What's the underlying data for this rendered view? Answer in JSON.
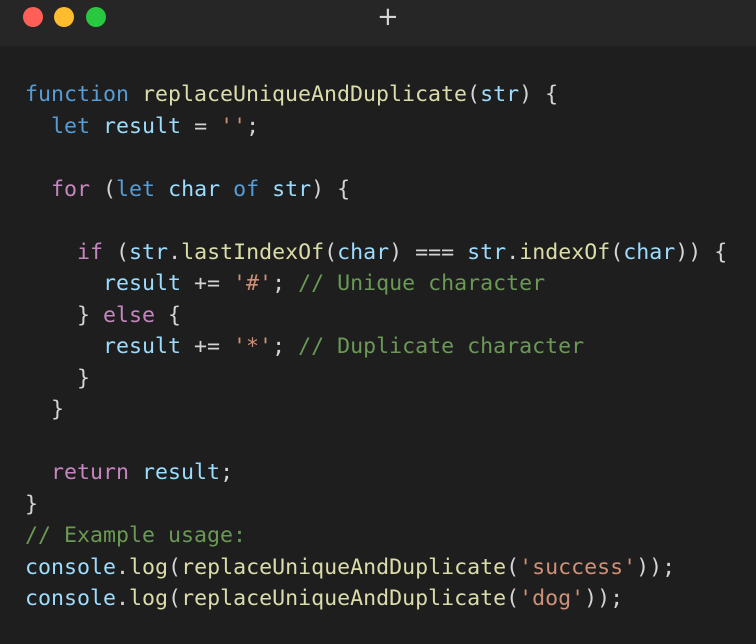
{
  "window": {
    "new_tab_icon": "plus-icon",
    "traffic_lights": [
      {
        "name": "close",
        "color": "#ff5f57"
      },
      {
        "name": "minimize",
        "color": "#febc2e"
      },
      {
        "name": "maximize",
        "color": "#28c840"
      }
    ]
  },
  "theme": {
    "keyword": "#569cd6",
    "control": "#c586c0",
    "function": "#dcdcaa",
    "variable": "#9cdcfe",
    "string": "#ce9178",
    "comment": "#6a9955",
    "punctuation": "#d4d4d4",
    "background": "#1e1e1e"
  },
  "code_lines": [
    [
      {
        "text": "function",
        "type": "kw"
      },
      {
        "text": " ",
        "type": "punc"
      },
      {
        "text": "replaceUniqueAndDuplicate",
        "type": "fn"
      },
      {
        "text": "(",
        "type": "punc"
      },
      {
        "text": "str",
        "type": "var"
      },
      {
        "text": ") {",
        "type": "punc"
      }
    ],
    [
      {
        "text": "  ",
        "type": "punc"
      },
      {
        "text": "let",
        "type": "kw"
      },
      {
        "text": " ",
        "type": "punc"
      },
      {
        "text": "result",
        "type": "var"
      },
      {
        "text": " = ",
        "type": "punc"
      },
      {
        "text": "''",
        "type": "str"
      },
      {
        "text": ";",
        "type": "punc"
      }
    ],
    [],
    [
      {
        "text": "  ",
        "type": "punc"
      },
      {
        "text": "for",
        "type": "ctrl"
      },
      {
        "text": " (",
        "type": "punc"
      },
      {
        "text": "let",
        "type": "kw"
      },
      {
        "text": " ",
        "type": "punc"
      },
      {
        "text": "char",
        "type": "var"
      },
      {
        "text": " ",
        "type": "punc"
      },
      {
        "text": "of",
        "type": "kw"
      },
      {
        "text": " ",
        "type": "punc"
      },
      {
        "text": "str",
        "type": "var"
      },
      {
        "text": ") {",
        "type": "punc"
      }
    ],
    [],
    [
      {
        "text": "    ",
        "type": "punc"
      },
      {
        "text": "if",
        "type": "ctrl"
      },
      {
        "text": " (",
        "type": "punc"
      },
      {
        "text": "str",
        "type": "var"
      },
      {
        "text": ".",
        "type": "punc"
      },
      {
        "text": "lastIndexOf",
        "type": "fn"
      },
      {
        "text": "(",
        "type": "punc"
      },
      {
        "text": "char",
        "type": "var"
      },
      {
        "text": ") ",
        "type": "punc"
      },
      {
        "text": "===",
        "type": "punc"
      },
      {
        "text": " ",
        "type": "punc"
      },
      {
        "text": "str",
        "type": "var"
      },
      {
        "text": ".",
        "type": "punc"
      },
      {
        "text": "indexOf",
        "type": "fn"
      },
      {
        "text": "(",
        "type": "punc"
      },
      {
        "text": "char",
        "type": "var"
      },
      {
        "text": ")) {",
        "type": "punc"
      }
    ],
    [
      {
        "text": "      ",
        "type": "punc"
      },
      {
        "text": "result",
        "type": "var"
      },
      {
        "text": " += ",
        "type": "punc"
      },
      {
        "text": "'#'",
        "type": "str"
      },
      {
        "text": "; ",
        "type": "punc"
      },
      {
        "text": "// Unique character",
        "type": "com"
      }
    ],
    [
      {
        "text": "    } ",
        "type": "punc"
      },
      {
        "text": "else",
        "type": "ctrl"
      },
      {
        "text": " {",
        "type": "punc"
      }
    ],
    [
      {
        "text": "      ",
        "type": "punc"
      },
      {
        "text": "result",
        "type": "var"
      },
      {
        "text": " += ",
        "type": "punc"
      },
      {
        "text": "'*'",
        "type": "str"
      },
      {
        "text": "; ",
        "type": "punc"
      },
      {
        "text": "// Duplicate character",
        "type": "com"
      }
    ],
    [
      {
        "text": "    }",
        "type": "punc"
      }
    ],
    [
      {
        "text": "  }",
        "type": "punc"
      }
    ],
    [],
    [
      {
        "text": "  ",
        "type": "punc"
      },
      {
        "text": "return",
        "type": "ctrl"
      },
      {
        "text": " ",
        "type": "punc"
      },
      {
        "text": "result",
        "type": "var"
      },
      {
        "text": ";",
        "type": "punc"
      }
    ],
    [
      {
        "text": "}",
        "type": "punc"
      }
    ],
    [
      {
        "text": "// Example usage:",
        "type": "com"
      }
    ],
    [
      {
        "text": "console",
        "type": "var"
      },
      {
        "text": ".",
        "type": "punc"
      },
      {
        "text": "log",
        "type": "fn"
      },
      {
        "text": "(",
        "type": "punc"
      },
      {
        "text": "replaceUniqueAndDuplicate",
        "type": "fn"
      },
      {
        "text": "(",
        "type": "punc"
      },
      {
        "text": "'success'",
        "type": "str"
      },
      {
        "text": "));",
        "type": "punc"
      }
    ],
    [
      {
        "text": "console",
        "type": "var"
      },
      {
        "text": ".",
        "type": "punc"
      },
      {
        "text": "log",
        "type": "fn"
      },
      {
        "text": "(",
        "type": "punc"
      },
      {
        "text": "replaceUniqueAndDuplicate",
        "type": "fn"
      },
      {
        "text": "(",
        "type": "punc"
      },
      {
        "text": "'dog'",
        "type": "str"
      },
      {
        "text": "));",
        "type": "punc"
      }
    ]
  ]
}
